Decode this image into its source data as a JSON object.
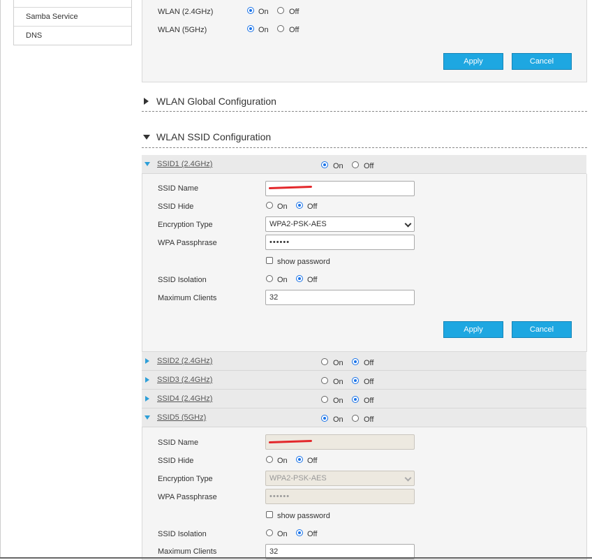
{
  "sidebar": {
    "items": [
      {
        "label": "Samba Service"
      },
      {
        "label": "DNS"
      }
    ]
  },
  "top_panel": {
    "rows": [
      {
        "label": "WLAN (2.4GHz)",
        "on": "On",
        "off": "Off",
        "value": "On"
      },
      {
        "label": "WLAN (5GHz)",
        "on": "On",
        "off": "Off",
        "value": "On"
      }
    ],
    "apply": "Apply",
    "cancel": "Cancel"
  },
  "sections": {
    "global": "WLAN Global Configuration",
    "ssid": "WLAN SSID Configuration"
  },
  "ssid1": {
    "title": "SSID1 (2.4GHz)",
    "on": "On",
    "off": "Off",
    "state": "On",
    "labels": {
      "name": "SSID Name",
      "hide": "SSID Hide",
      "enc": "Encryption Type",
      "pass": "WPA Passphrase",
      "show_password": "show password",
      "isolation": "SSID Isolation",
      "max_clients": "Maximum Clients"
    },
    "hide_value": "Off",
    "encryption": "WPA2-PSK-AES",
    "passphrase": "••••••",
    "show_password_checked": false,
    "isolation_value": "Off",
    "max_clients": "32",
    "apply": "Apply",
    "cancel": "Cancel"
  },
  "collapsed_ssids": [
    {
      "title": "SSID2 (2.4GHz)",
      "on": "On",
      "off": "Off",
      "state": "Off"
    },
    {
      "title": "SSID3 (2.4GHz)",
      "on": "On",
      "off": "Off",
      "state": "Off"
    },
    {
      "title": "SSID4 (2.4GHz)",
      "on": "On",
      "off": "Off",
      "state": "Off"
    }
  ],
  "ssid5": {
    "title": "SSID5 (5GHz)",
    "on": "On",
    "off": "Off",
    "state": "On",
    "labels": {
      "name": "SSID Name",
      "hide": "SSID Hide",
      "enc": "Encryption Type",
      "pass": "WPA Passphrase",
      "show_password": "show password",
      "isolation": "SSID Isolation",
      "max_clients": "Maximum Clients"
    },
    "hide_value": "Off",
    "encryption": "WPA2-PSK-AES",
    "passphrase": "••••••",
    "show_password_checked": false,
    "isolation_value": "Off",
    "max_clients": "32"
  },
  "colors": {
    "button": "#1ea7e1",
    "radio_selected": "#1a73e8",
    "expander_arrow": "#2d9fd8",
    "redaction": "#e3282b"
  }
}
